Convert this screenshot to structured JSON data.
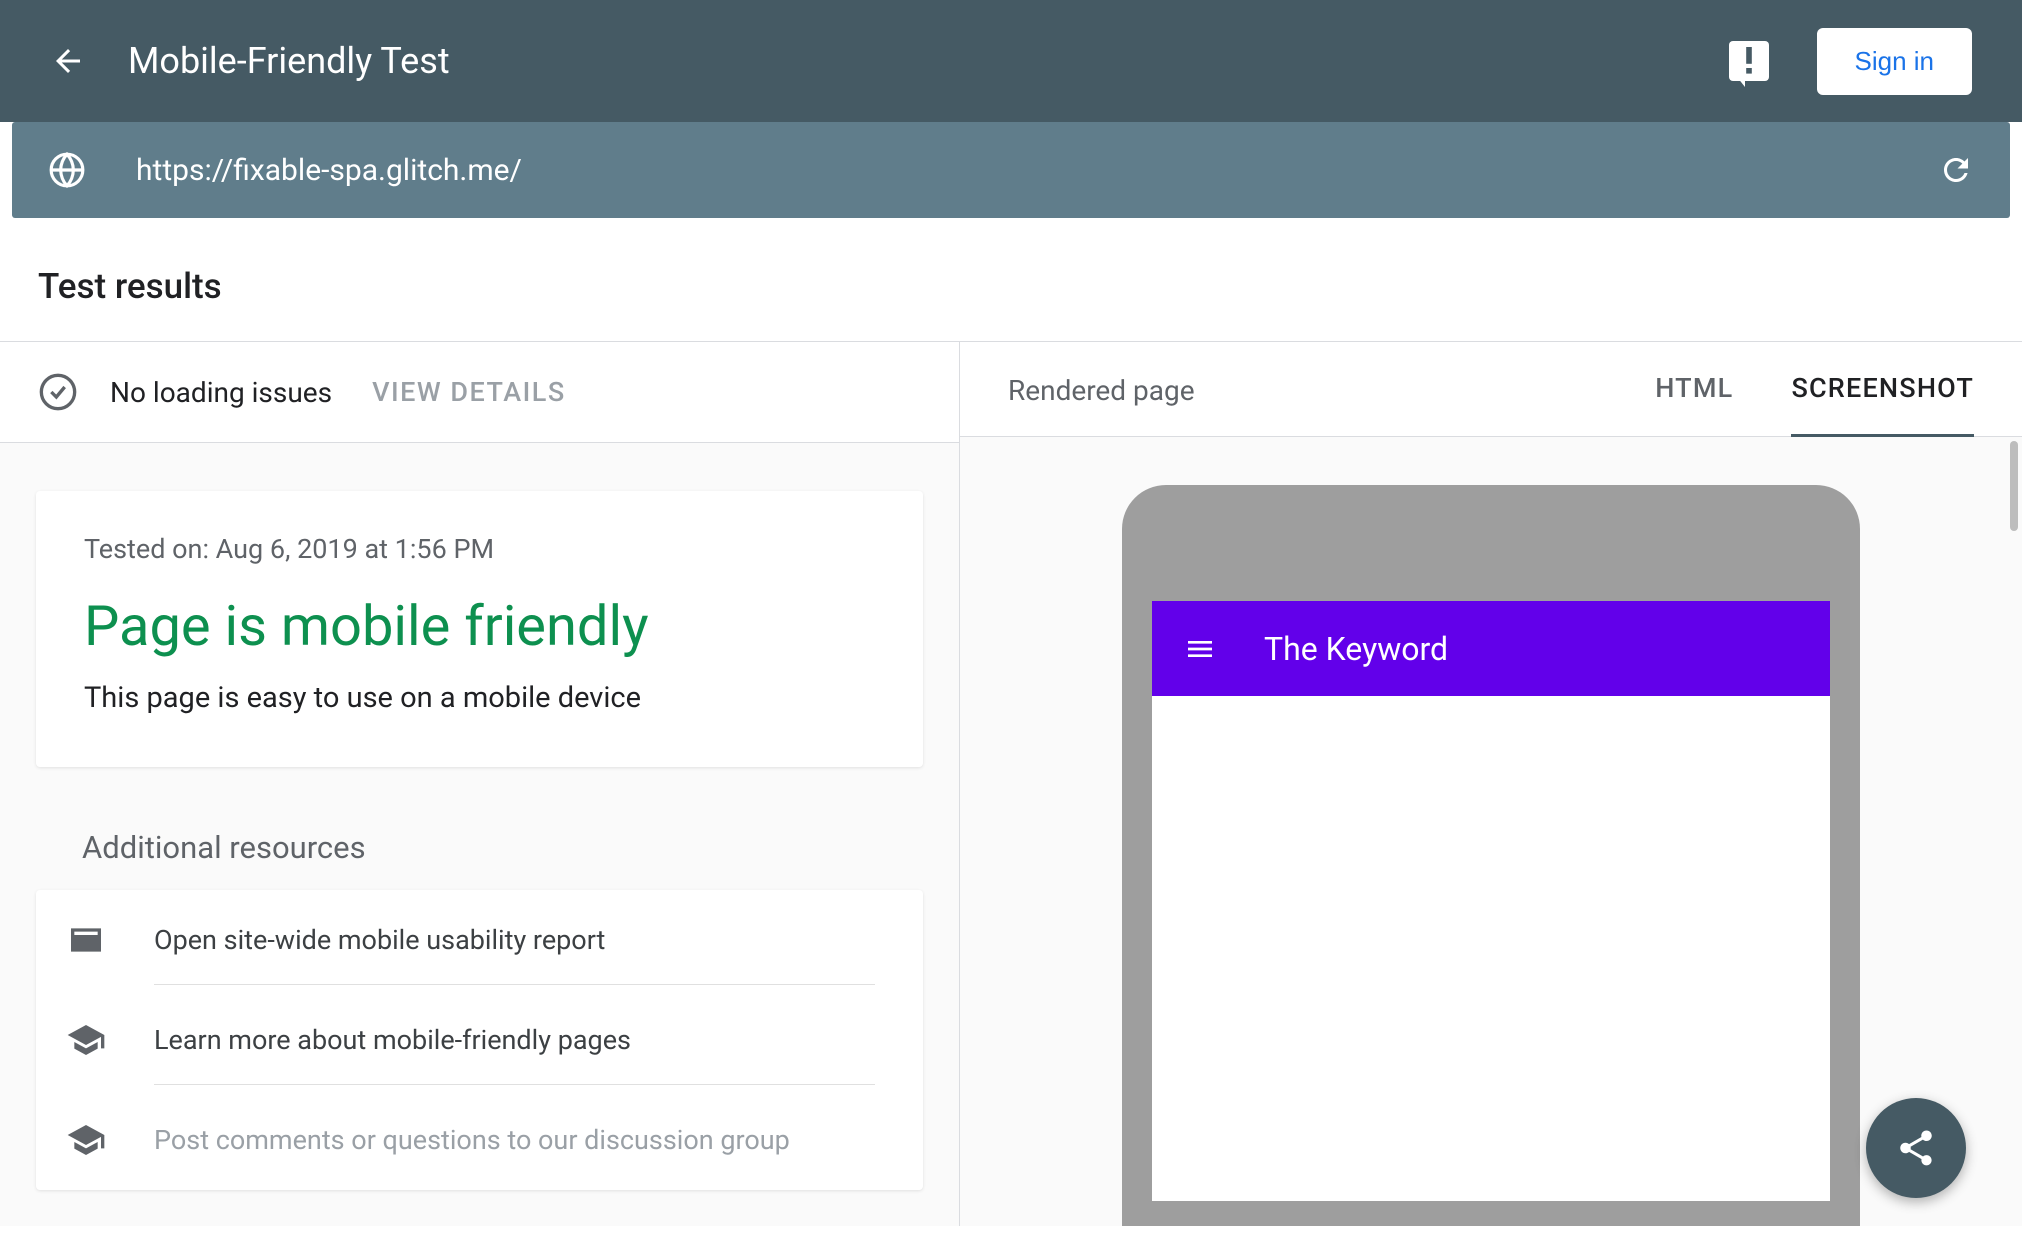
{
  "header": {
    "app_title": "Mobile-Friendly Test",
    "sign_in_label": "Sign in"
  },
  "url_bar": {
    "url": "https://fixable-spa.glitch.me/"
  },
  "section": {
    "title": "Test results"
  },
  "status": {
    "loading_text": "No loading issues",
    "view_details_label": "VIEW DETAILS"
  },
  "result": {
    "tested_on": "Tested on: Aug 6, 2019 at 1:56 PM",
    "verdict": "Page is mobile friendly",
    "description": "This page is easy to use on a mobile device"
  },
  "resources": {
    "title": "Additional resources",
    "items": [
      "Open site-wide mobile usability report",
      "Learn more about mobile-friendly pages",
      "Post comments or questions to our discussion group"
    ]
  },
  "right_panel": {
    "rendered_label": "Rendered page",
    "tabs": {
      "html": "HTML",
      "screenshot": "SCREENSHOT"
    }
  },
  "preview": {
    "site_title": "The Keyword"
  }
}
